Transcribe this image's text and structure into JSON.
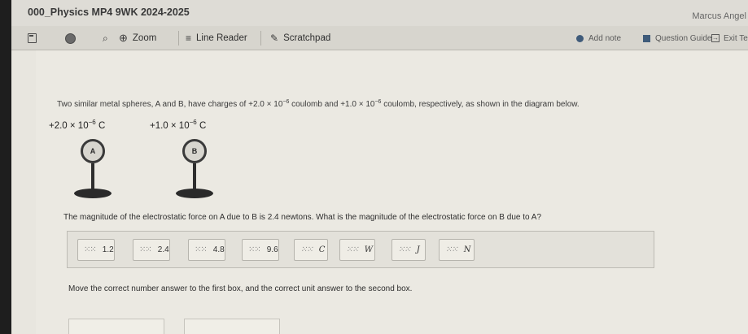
{
  "header": {
    "course_title": "000_Physics MP4 9WK 2024-2025",
    "user_name": "Marcus Angel"
  },
  "toolbar": {
    "zoom_label": "Zoom",
    "line_reader_label": "Line Reader",
    "scratchpad_label": "Scratchpad",
    "add_note_label": "Add note",
    "question_guide_label": "Question Guide",
    "exit_label": "Exit Te"
  },
  "question": {
    "intro_1": "Two similar metal spheres, A and B, have charges of +2.0 × 10",
    "intro_exp_1": "−6",
    "intro_2": " coulomb and +1.0 × 10",
    "intro_exp_2": "−6",
    "intro_3": " coulomb, respectively, as shown in the diagram below.",
    "charge_a_base": "+2.0 × 10",
    "charge_a_exp": "−6",
    "charge_a_unit": "C",
    "charge_b_base": "+1.0 × 10",
    "charge_b_exp": "−6",
    "charge_b_unit": "C",
    "sphere_a_label": "A",
    "sphere_b_label": "B",
    "magnitude_text": "The magnitude of the electrostatic force on A due to B is 2.4 newtons. What is the magnitude of the electrostatic force on B due to A?",
    "instruction": "Move the correct number answer to the first box, and the correct unit answer to the second box."
  },
  "answer_options": [
    {
      "label": "1.2"
    },
    {
      "label": "2.4"
    },
    {
      "label": "4.8"
    },
    {
      "label": "9.6"
    },
    {
      "label": "C"
    },
    {
      "label": "W"
    },
    {
      "label": "J"
    },
    {
      "label": "N"
    }
  ]
}
